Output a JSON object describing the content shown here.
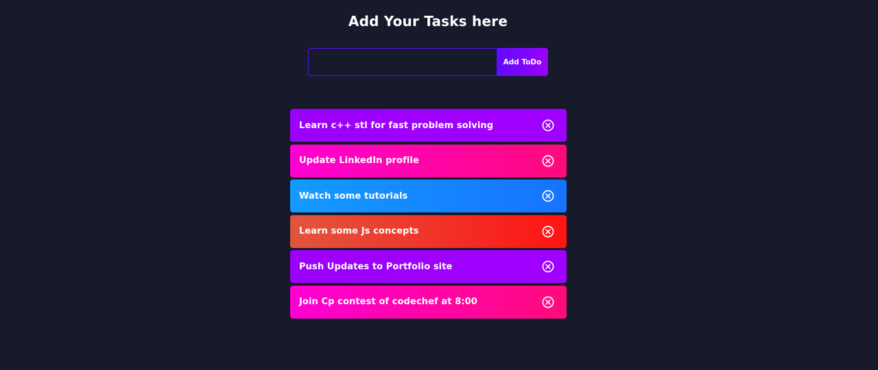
{
  "header": {
    "title": "Add Your Tasks here"
  },
  "form": {
    "input_value": "",
    "input_placeholder": "",
    "button_label": "Add ToDo"
  },
  "todos": [
    {
      "text": "Learn c++ stl for fast problem solving",
      "gradient": [
        "#9b00fa",
        "#a000ff"
      ],
      "icon": "close-circle-icon"
    },
    {
      "text": "Update LinkedIn profile",
      "gradient": [
        "#ff00d4",
        "#ff0a7c"
      ],
      "icon": "close-circle-icon"
    },
    {
      "text": "Watch some tutorials",
      "gradient": [
        "#149bff",
        "#1672ff"
      ],
      "icon": "close-circle-icon"
    },
    {
      "text": "Learn some Js concepts",
      "gradient": [
        "#e0553e",
        "#ff1414"
      ],
      "icon": "close-circle-icon"
    },
    {
      "text": "Push Updates to Portfolio site",
      "gradient": [
        "#9b00fa",
        "#a000ff"
      ],
      "icon": "close-circle-icon"
    },
    {
      "text": "Join Cp contest of codechef at 8:00",
      "gradient": [
        "#ff00d4",
        "#ff0a7c"
      ],
      "icon": "close-circle-icon"
    }
  ],
  "colors": {
    "background": "#161a2b",
    "accent": "#5d0cff",
    "text": "#ffffff"
  }
}
